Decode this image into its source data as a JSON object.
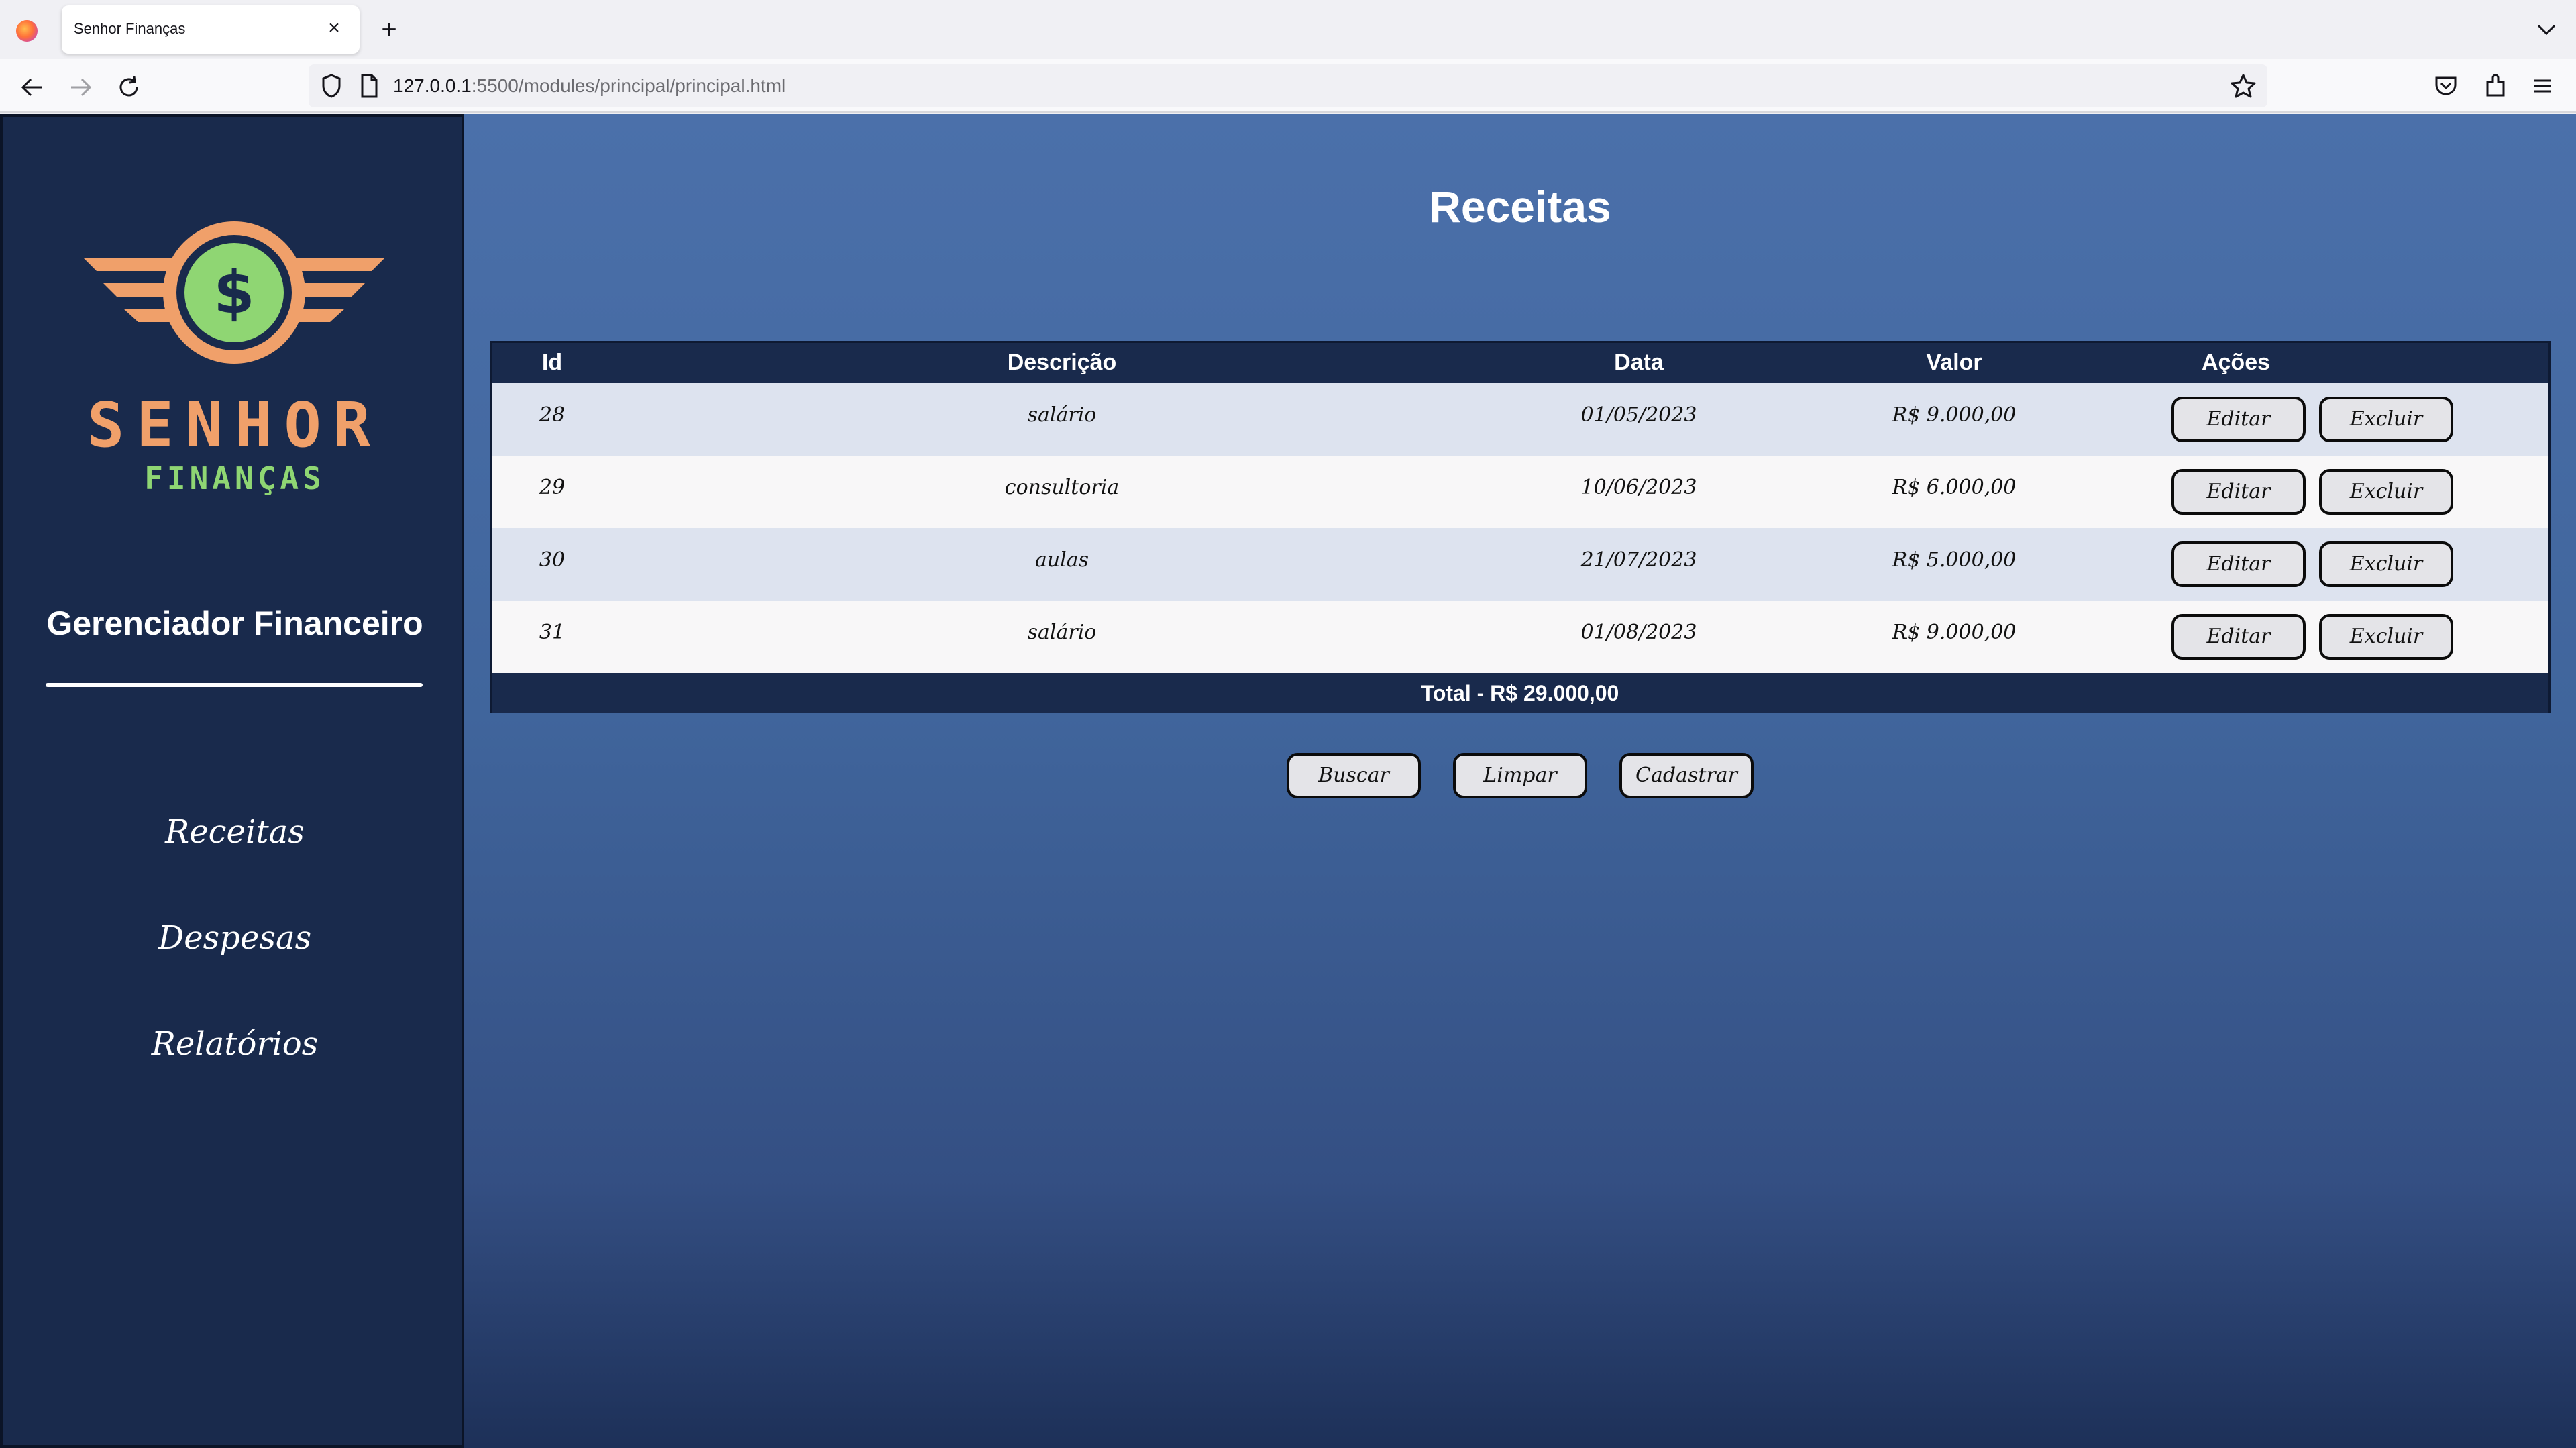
{
  "browser": {
    "tab_title": "Senhor Finanças",
    "url_host": "127.0.0.1",
    "url_rest": ":5500/modules/principal/principal.html"
  },
  "sidebar": {
    "brand_title": "SENHOR",
    "brand_subtitle": "FINANÇAS",
    "heading": "Gerenciador Financeiro",
    "menu": [
      {
        "label": "Receitas"
      },
      {
        "label": "Despesas"
      },
      {
        "label": "Relatórios"
      }
    ]
  },
  "main": {
    "title": "Receitas",
    "table": {
      "headers": {
        "id": "Id",
        "descricao": "Descrição",
        "data": "Data",
        "valor": "Valor",
        "acoes": "Ações"
      },
      "rows": [
        {
          "id": "28",
          "descricao": "salário",
          "data": "01/05/2023",
          "valor": "R$ 9.000,00"
        },
        {
          "id": "29",
          "descricao": "consultoria",
          "data": "10/06/2023",
          "valor": "R$ 6.000,00"
        },
        {
          "id": "30",
          "descricao": "aulas",
          "data": "21/07/2023",
          "valor": "R$ 5.000,00"
        },
        {
          "id": "31",
          "descricao": "salário",
          "data": "01/08/2023",
          "valor": "R$ 9.000,00"
        }
      ],
      "edit_label": "Editar",
      "delete_label": "Excluir",
      "total": "Total -  R$ 29.000,00"
    },
    "buttons": {
      "buscar": "Buscar",
      "limpar": "Limpar",
      "cadastrar": "Cadastrar"
    }
  },
  "colors": {
    "sidebar_bg": "#192a4c",
    "main_bg": "#4b70aa",
    "brand_orange": "#f0a06a",
    "brand_green": "#8fd673"
  },
  "icons": [
    "firefox-logo-icon",
    "close-icon",
    "plus-icon",
    "chevron-down-icon",
    "back-arrow-icon",
    "forward-arrow-icon",
    "reload-icon",
    "shield-icon",
    "page-icon",
    "star-icon",
    "pocket-icon",
    "extensions-icon",
    "menu-icon"
  ]
}
